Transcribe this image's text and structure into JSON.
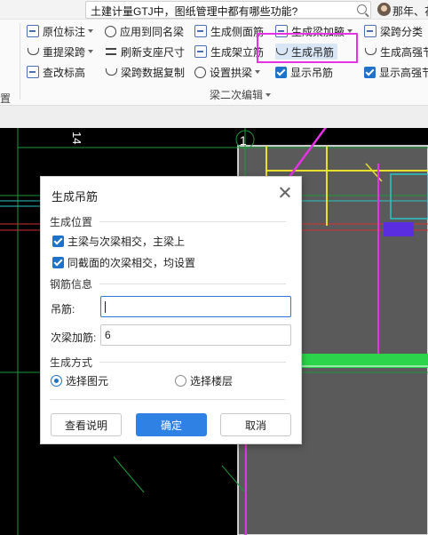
{
  "search": {
    "query": "土建计量GTJ中，图纸管理中都有哪些功能?"
  },
  "user": {
    "name": "那年、花"
  },
  "ribbon": {
    "col1": [
      "原位标注",
      "重提梁跨",
      "查改标高"
    ],
    "col2": [
      "应用到同名梁",
      "刷新支座尺寸",
      "梁跨数据复制"
    ],
    "col3": [
      "生成侧面筋",
      "生成架立筋",
      "设置拱梁"
    ],
    "col4": [
      "生成梁加腋",
      "生成吊筋",
      "显示吊筋"
    ],
    "col5": [
      "梁跨分类",
      "生成高强节",
      "显示高强节"
    ],
    "group_label": "梁二次编辑",
    "left_group_label": "置"
  },
  "canvas": {
    "axis_number": "1",
    "axis_number_left": "14"
  },
  "dialog": {
    "title": "生成吊筋",
    "position_section": "生成位置",
    "option1": "主梁与次梁相交，主梁上",
    "option2": "同截面的次梁相交，均设置",
    "rebar_section": "钢筋信息",
    "hanger_label": "吊筋:",
    "hanger_value": "",
    "secondary_label": "次梁加筋:",
    "secondary_value": "6",
    "method_section": "生成方式",
    "radio1": "选择图元",
    "radio2": "选择楼层",
    "help_button": "查看说明",
    "ok_button": "确定",
    "cancel_button": "取消"
  },
  "colors": {
    "accent": "#2f81e4",
    "highlight": "#e432e4",
    "cad_background": "#000000"
  }
}
